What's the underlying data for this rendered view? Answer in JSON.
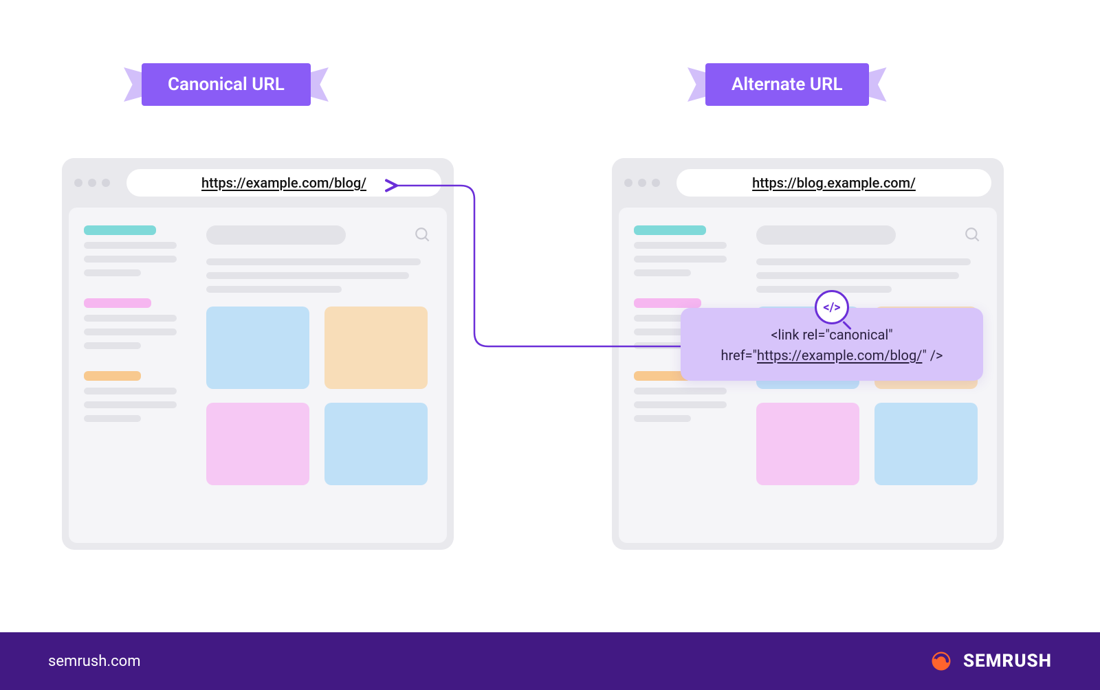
{
  "labels": {
    "canonical": "Canonical URL",
    "alternate": "Alternate URL"
  },
  "browsers": {
    "canonical_url": "https://example.com/blog/",
    "alternate_url": "https://blog.example.com/"
  },
  "callout": {
    "line1": "<link rel=\"canonical\"",
    "line2_prefix": "href=\"",
    "line2_url": "https://example.com/blog/",
    "line2_suffix": "\" />",
    "icon_text": "</>"
  },
  "footer": {
    "site": "semrush.com",
    "brand": "SEMRUSH"
  },
  "colors": {
    "primary_purple": "#8A5CF6",
    "light_purple": "#D7C4FA",
    "deep_purple": "#421983",
    "arrow": "#6B2FD8",
    "brand_orange": "#FF642D"
  }
}
